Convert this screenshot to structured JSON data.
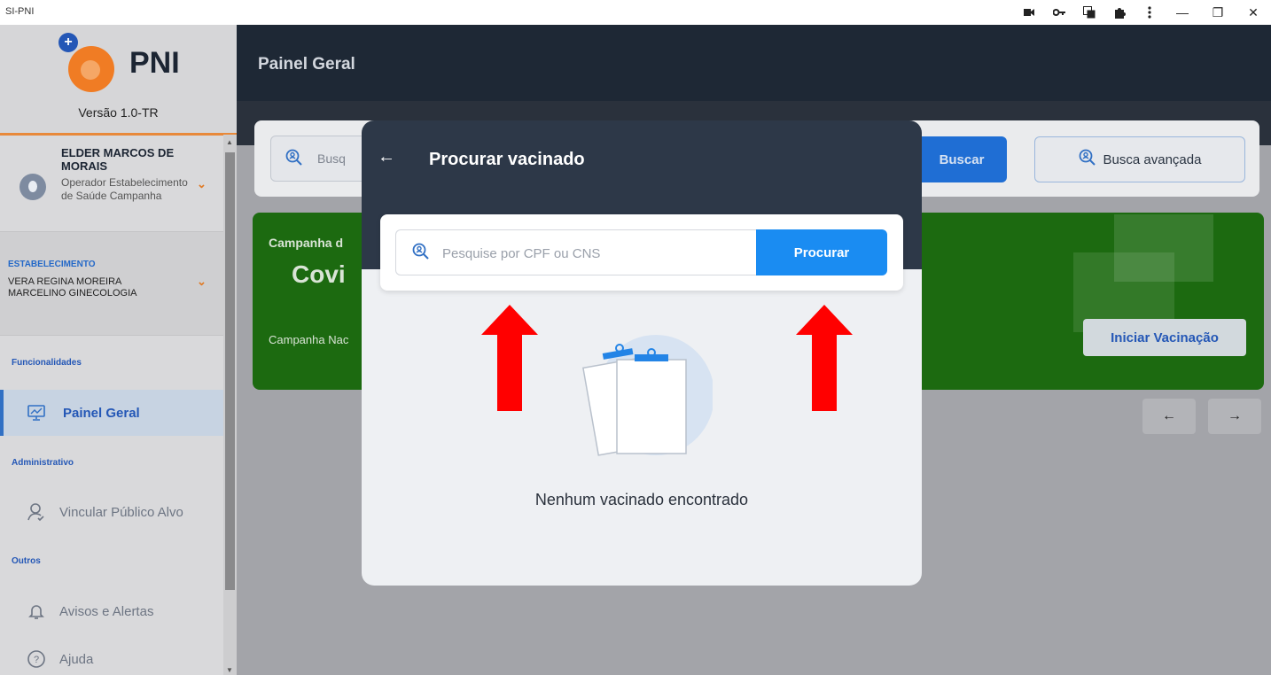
{
  "window": {
    "title": "SI-PNI",
    "toolbar_icons": [
      "camera-icon",
      "key-icon",
      "translate-icon",
      "extension-icon",
      "more-icon"
    ],
    "minimize": "—",
    "restore": "❐",
    "close": "✕"
  },
  "sidebar": {
    "logo_text": "PNI",
    "version": "Versão 1.0-TR",
    "user": {
      "name": "ELDER MARCOS DE MORAIS",
      "role": "Operador Estabelecimento de Saúde Campanha"
    },
    "estab": {
      "label": "ESTABELECIMENTO",
      "name": "VERA REGINA MOREIRA MARCELINO GINECOLOGIA"
    },
    "sections": {
      "funcionalidades": "Funcionalidades",
      "administrativo": "Administrativo",
      "outros": "Outros"
    },
    "items": {
      "painel": "Painel Geral",
      "vincular": "Vincular Público Alvo",
      "avisos": "Avisos e Alertas",
      "ajuda": "Ajuda"
    }
  },
  "main": {
    "title": "Painel Geral",
    "search_placeholder_partial": "Busq",
    "buscar": "Buscar",
    "busca_avancada": "Busca avançada",
    "campaign": {
      "label_partial": "Campanha d",
      "title_partial": "Covi",
      "sub_partial": "Campanha Nac",
      "start_button": "Iniciar Vacinação"
    },
    "prev_arrow": "←",
    "next_arrow": "→"
  },
  "modal": {
    "back_arrow": "←",
    "title": "Procurar vacinado",
    "search_placeholder": "Pesquise por CPF ou CNS",
    "search_button": "Procurar",
    "empty_text": "Nenhum vacinado encontrado"
  },
  "colors": {
    "accent_blue": "#1a8cf2",
    "header_dark": "#2d3848",
    "campaign_green": "#1c6a10",
    "brand_orange": "#f07c24",
    "annotation_red": "#ff0000"
  }
}
